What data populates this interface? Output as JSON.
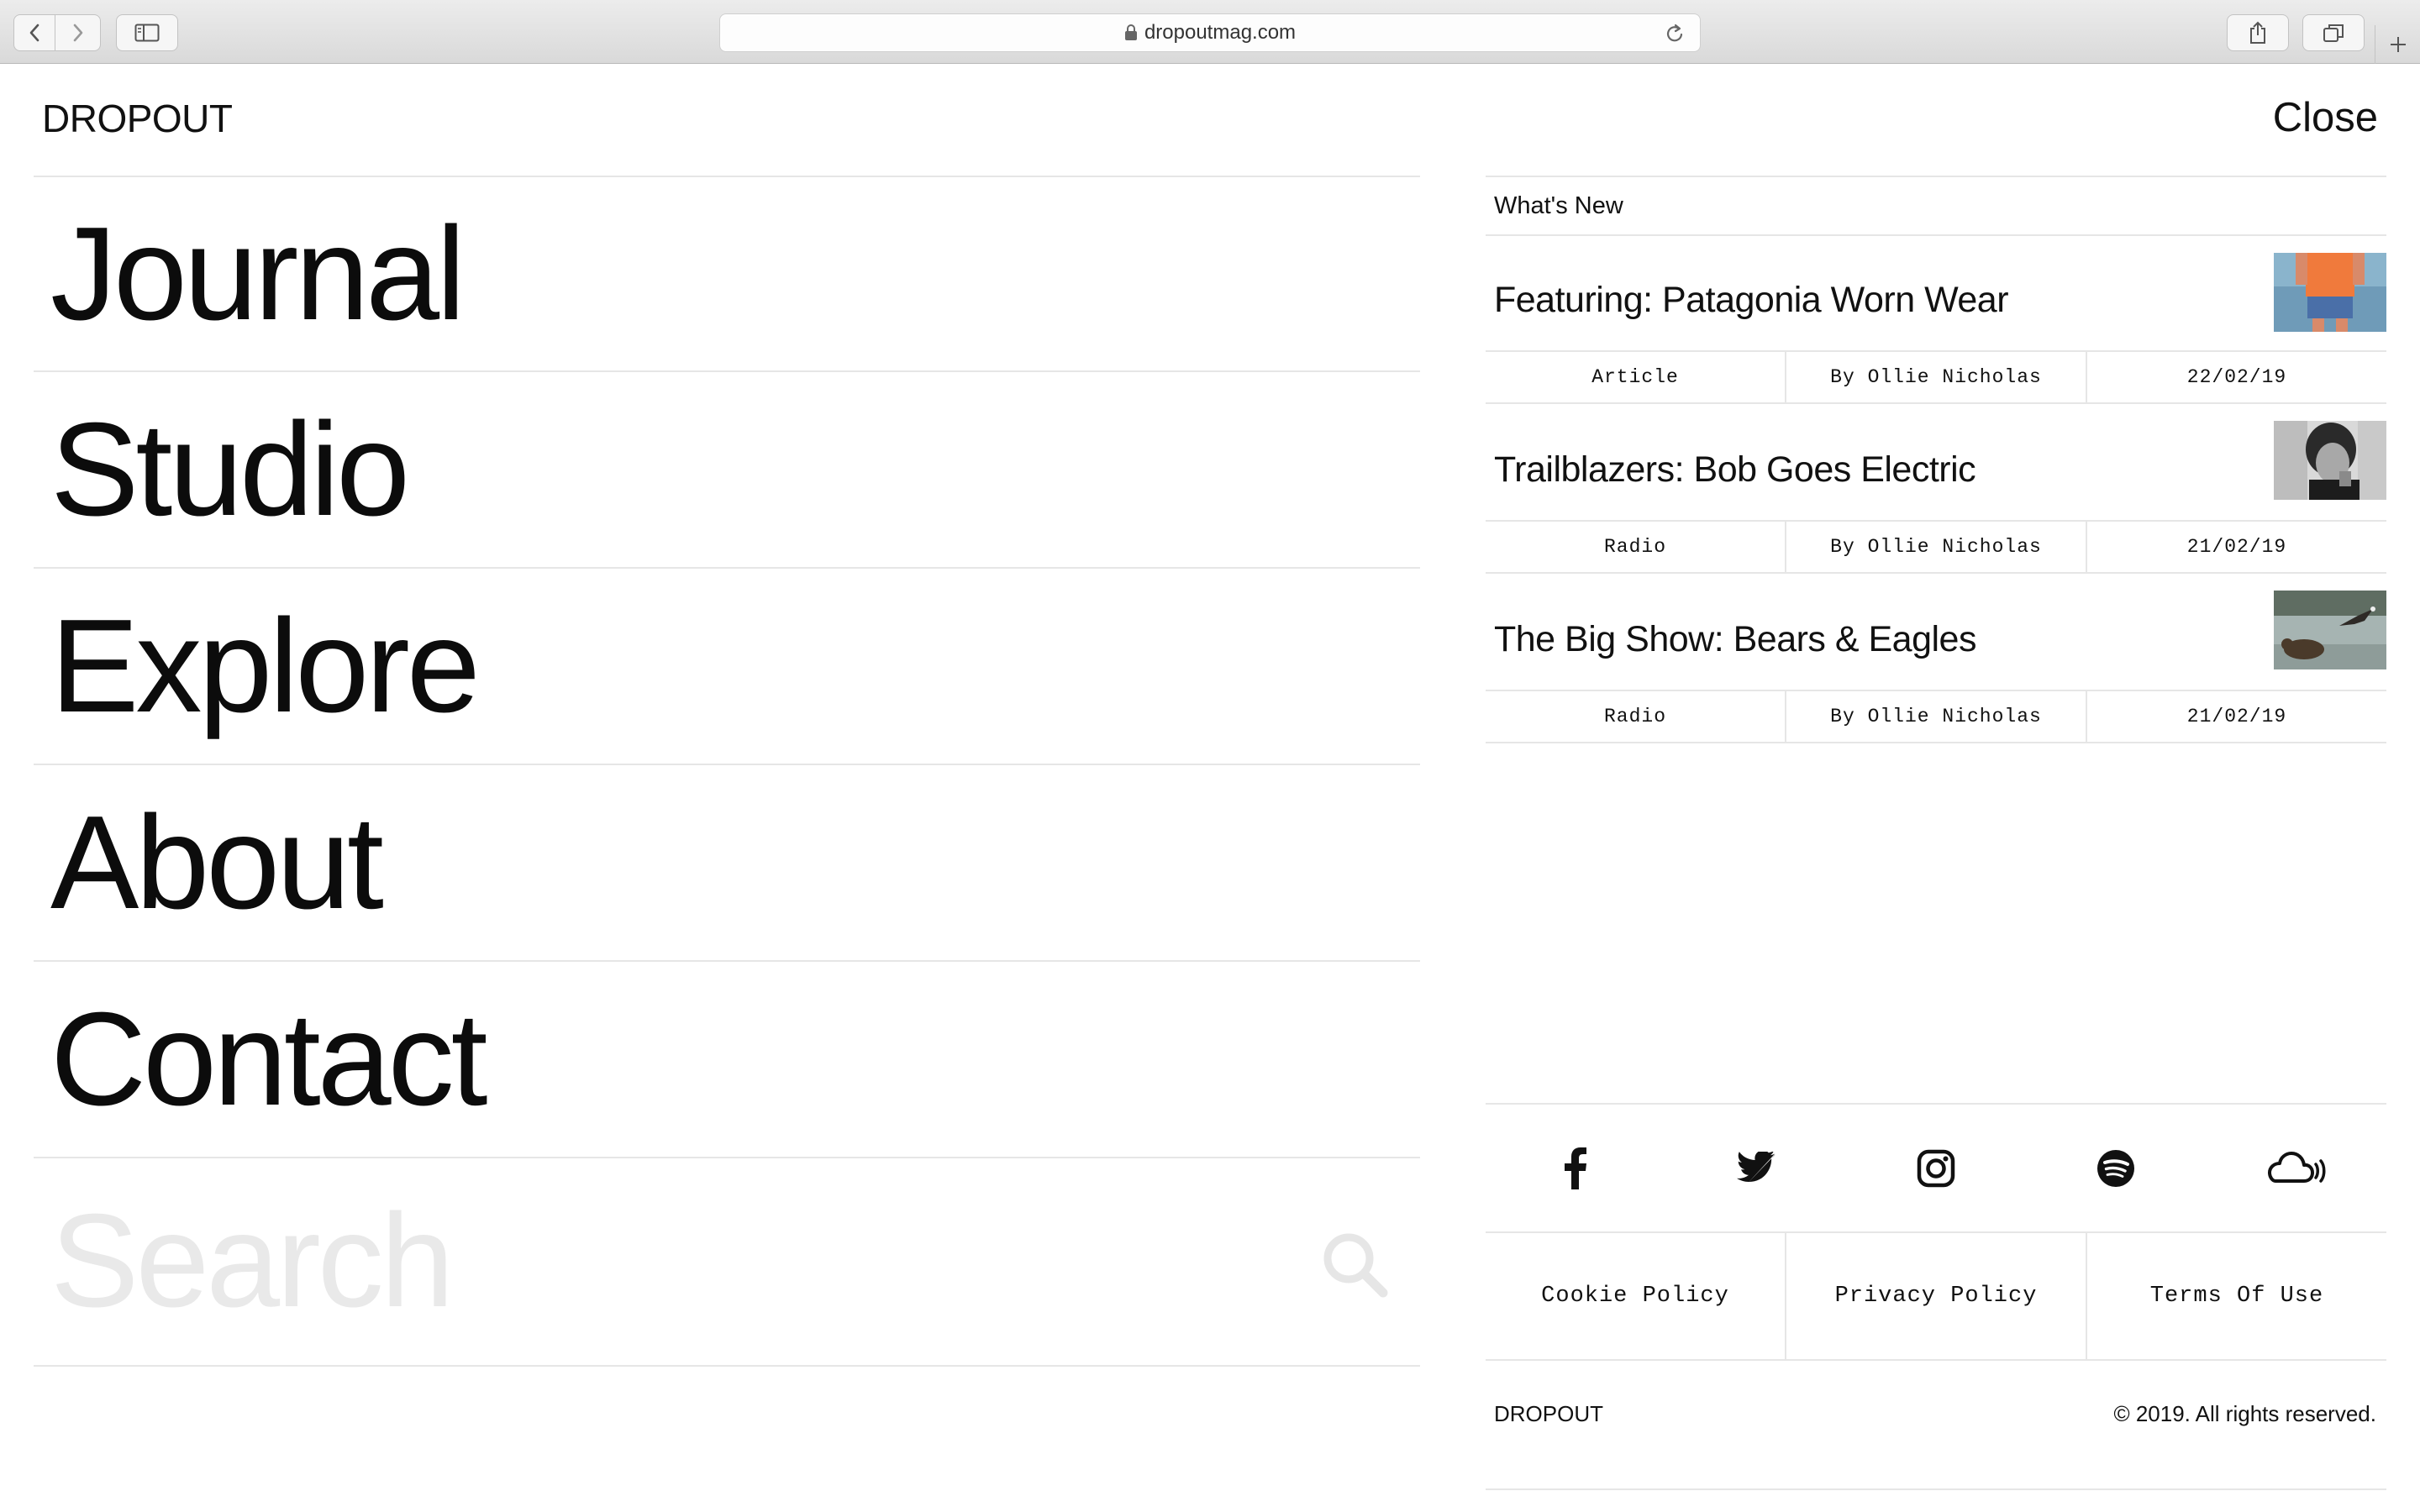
{
  "browser": {
    "url": "dropoutmag.com"
  },
  "header": {
    "logo": "DROPOUT",
    "close_label": "Close"
  },
  "nav": {
    "items": [
      {
        "label": "Journal"
      },
      {
        "label": "Studio"
      },
      {
        "label": "Explore"
      },
      {
        "label": "About"
      },
      {
        "label": "Contact"
      }
    ]
  },
  "search": {
    "placeholder": "Search"
  },
  "whats_new": {
    "heading": "What's New",
    "items": [
      {
        "title": "Featuring: Patagonia Worn Wear",
        "type": "Article",
        "author": "By Ollie Nicholas",
        "date": "22/02/19"
      },
      {
        "title": "Trailblazers: Bob Goes Electric",
        "type": "Radio",
        "author": "By Ollie Nicholas",
        "date": "21/02/19"
      },
      {
        "title": "The Big Show: Bears & Eagles",
        "type": "Radio",
        "author": "By Ollie Nicholas",
        "date": "21/02/19"
      }
    ]
  },
  "social": {
    "icons": [
      "facebook-icon",
      "twitter-icon",
      "instagram-icon",
      "spotify-icon",
      "soundcloud-icon"
    ]
  },
  "policies": {
    "cookie": "Cookie Policy",
    "privacy": "Privacy Policy",
    "terms": "Terms Of Use"
  },
  "footer": {
    "logo": "DROPOUT",
    "copyright": "© 2019. All rights reserved."
  }
}
